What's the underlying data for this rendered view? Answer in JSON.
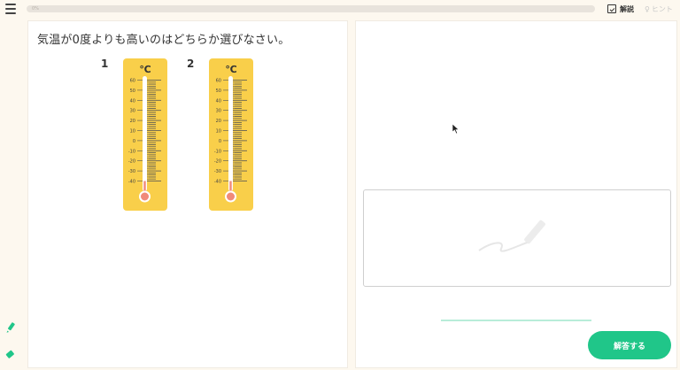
{
  "toolbar": {
    "progress_label": "0%",
    "progress": 0,
    "kaisetsu_label": "解説",
    "hint_label": "ヒント"
  },
  "question": {
    "text": "気温が0度よりも高いのはどちらか選びなさい。"
  },
  "options": [
    {
      "number": "1",
      "unit": "℃",
      "level_celsius": -40
    },
    {
      "number": "2",
      "unit": "℃",
      "level_celsius": -40
    }
  ],
  "thermometer_scale": [
    "60",
    "50",
    "40",
    "30",
    "20",
    "10",
    "0",
    "-10",
    "-20",
    "-30",
    "-40"
  ],
  "answer": {
    "submit_label": "解答する"
  },
  "colors": {
    "accent": "#20c689",
    "thermometer_body": "#f9cf4a",
    "bulb": "#f08a7a",
    "background": "#fdf8ef"
  },
  "icons": [
    "menu-icon",
    "kaisetsu-icon",
    "hint-icon",
    "pen-icon",
    "eraser-icon",
    "mouse-cursor-icon"
  ]
}
